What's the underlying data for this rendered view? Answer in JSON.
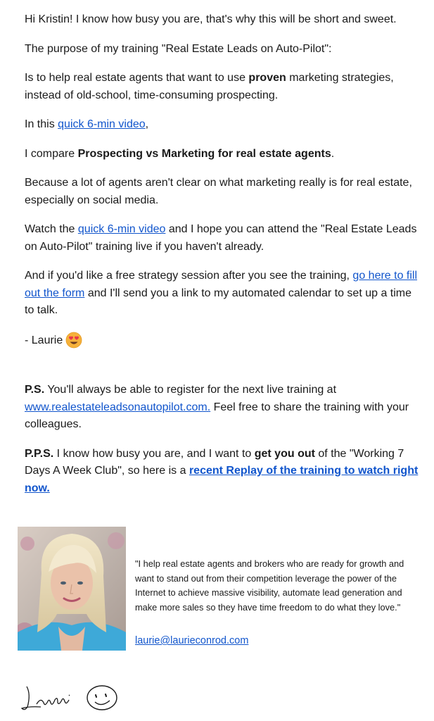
{
  "email": {
    "greeting": "Hi Kristin! I know how busy you are, that's why this will be short and sweet.",
    "purpose_line": "The purpose of my training \"Real Estate Leads on Auto-Pilot\":",
    "help_pre": "Is to help real estate agents that want to use ",
    "help_bold": "proven",
    "help_post": " marketing strategies, instead of old-school, time-consuming prospecting.",
    "video_pre": "In this ",
    "video_link": "quick 6-min video",
    "video_post": ",",
    "compare_pre": "I compare ",
    "compare_bold": "Prospecting vs Marketing for real estate agents",
    "compare_post": ".",
    "because_line": "Because a lot of agents aren't clear on what marketing really is for real estate, especially on social media.",
    "watch_pre": "Watch the ",
    "watch_link": "quick 6-min video",
    "watch_post": " and I hope you can attend the \"Real Estate Leads on Auto-Pilot\" training live if you haven't already.",
    "session_pre": "And if you'd like a free strategy session after you see the training, ",
    "session_link": "go here to fill out the form",
    "session_post": " and I'll send you a link to my automated calendar to set up a time to talk.",
    "signoff": "- Laurie",
    "ps_label": "P.S.",
    "ps_pre": " You'll always be able to register for the next live training at ",
    "ps_link": "www.realestateleadsonautopilot.com.",
    "ps_post": " Feel free to share the training with your colleagues.",
    "pps_label": "P.P.S.",
    "pps_pre": " I know how busy you are, and I want to ",
    "pps_bold": "get you out",
    "pps_mid": " of the \"Working 7 Days A Week Club\", so here is a ",
    "pps_link": "recent Replay of the training to watch right now."
  },
  "signature": {
    "quote": "\"I help real estate agents and brokers who are ready for growth and want to stand out from their competition leverage the power of the Internet to achieve massive visibility, automate lead generation and make more sales so they have time freedom to do what they love.\"",
    "email": "laurie@laurieconrod.com"
  },
  "icons": {
    "signoff_emoji": "heart-eyes-emoji-icon",
    "handwritten_signature": "Laurie"
  },
  "colors": {
    "link": "#1155cc",
    "text": "#1a1a1a"
  }
}
